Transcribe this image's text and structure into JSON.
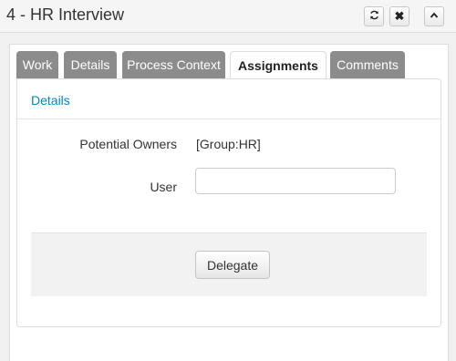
{
  "window": {
    "title": "4 - HR Interview",
    "buttons": {
      "refresh_icon": "refresh-icon",
      "close_glyph": "✖",
      "collapse_glyph": "⌃"
    }
  },
  "tabs": [
    {
      "label": "Work",
      "active": false
    },
    {
      "label": "Details",
      "active": false
    },
    {
      "label": "Process Context",
      "active": false
    },
    {
      "label": "Assignments",
      "active": true
    },
    {
      "label": "Comments",
      "active": false
    }
  ],
  "section": {
    "title": "Details"
  },
  "form": {
    "potential_owners_label": "Potential Owners",
    "potential_owners_value": "[Group:HR]",
    "user_label": "User",
    "user_value": "",
    "user_placeholder": ""
  },
  "actions": {
    "delegate_label": "Delegate"
  },
  "colors": {
    "tab_inactive": "#8c8c8c",
    "link": "#0088cc",
    "action_bar": "#f2f2f2"
  }
}
